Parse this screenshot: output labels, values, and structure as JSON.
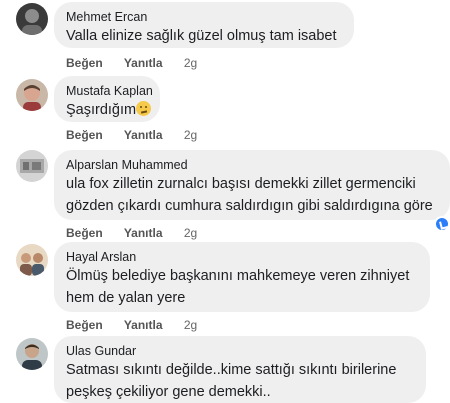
{
  "comments": [
    {
      "name": "Mehmet Ercan",
      "text_lines": [
        "Valla elinize sağlık güzel olmuş tam isabet"
      ],
      "actions": {
        "like": "Beğen",
        "reply": "Yanıtla",
        "time": "2g"
      }
    },
    {
      "name": "Mustafa Kaplan",
      "text_lines": [
        "Şaşırdığım"
      ],
      "emoji": "thinking-face-emoji",
      "actions": {
        "like": "Beğen",
        "reply": "Yanıtla",
        "time": "2g"
      }
    },
    {
      "name": "Alparslan Muhammed",
      "text_lines": [
        "ula fox zilletin zurnalcı başısı demekki zillet germenciki",
        "gözden çıkardı cumhura saldırdıgın gibi saldırdıgına göre"
      ],
      "reaction": "like-reaction-badge",
      "actions": {
        "like": "Beğen",
        "reply": "Yanıtla",
        "time": "2g"
      }
    },
    {
      "name": "Hayal Arslan",
      "text_lines": [
        "Ölmüş belediye başkanını mahkemeye veren zihniyet",
        "hem de yalan yere"
      ],
      "actions": {
        "like": "Beğen",
        "reply": "Yanıtla",
        "time": "2g"
      }
    },
    {
      "name": "Ulas Gundar",
      "text_lines": [
        "Satması sıkıntı değilde..kime sattığı sıkıntı birilerine",
        "peşkeş çekiliyor gene demekki.."
      ]
    }
  ],
  "colors": {
    "bubble": "#efefef",
    "text": "#1c1e21",
    "action": "#555555",
    "like_badge": "#2d7ff9"
  }
}
